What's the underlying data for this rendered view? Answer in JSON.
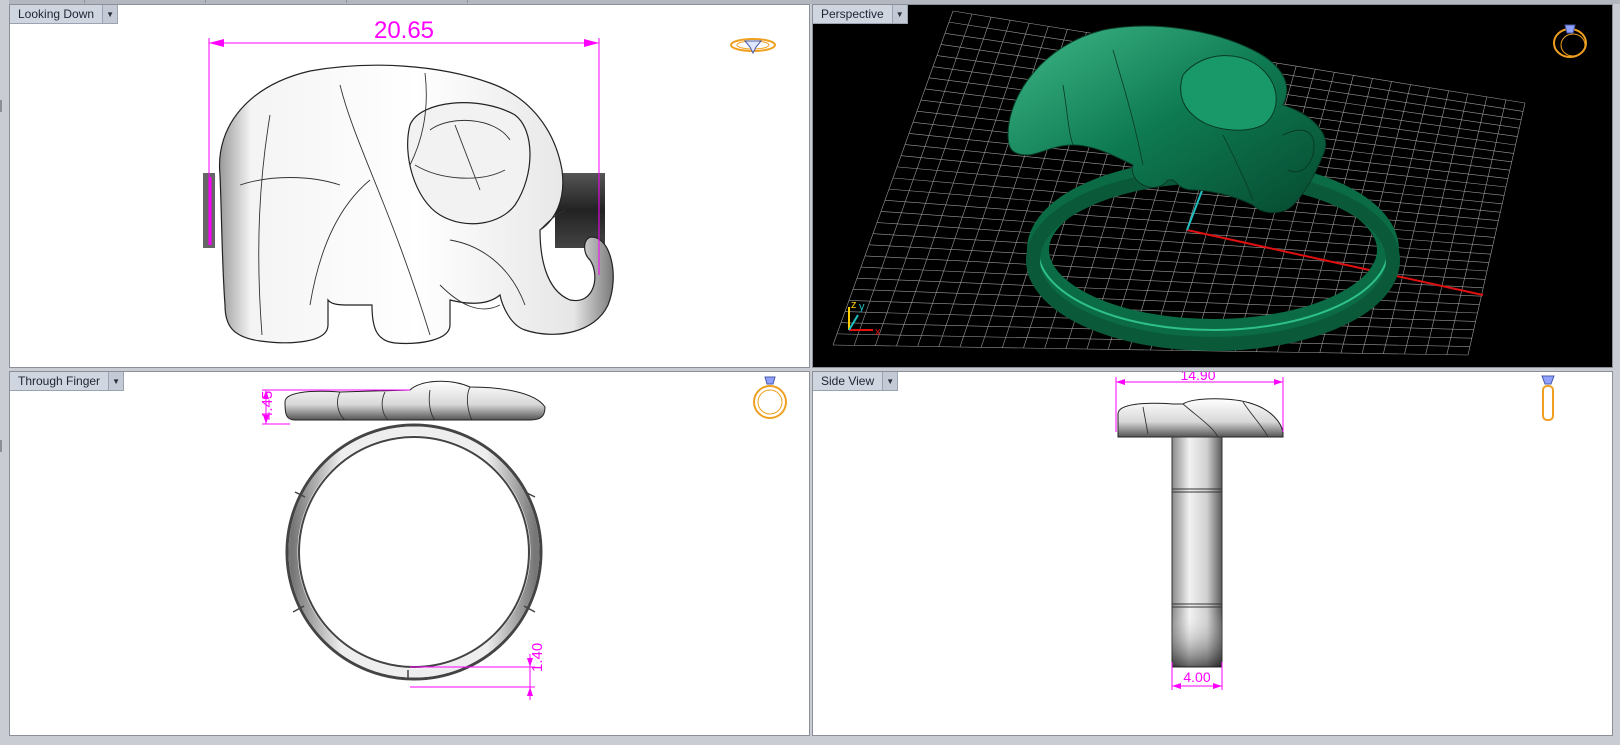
{
  "viewports": [
    {
      "title": "Looking Down",
      "dimensions": [
        "20.65"
      ]
    },
    {
      "title": "Perspective",
      "axis_labels": {
        "z": "z",
        "y": "y",
        "x": "x"
      }
    },
    {
      "title": "Through Finger",
      "dimensions": [
        "4.45",
        "1.40"
      ]
    },
    {
      "title": "Side View",
      "dimensions": [
        "14.90",
        "4.00"
      ]
    }
  ],
  "colors": {
    "dimension": "#ff00ff",
    "model_green": "#0f8a5a",
    "grid": "#9a9a9a",
    "axis_x": "#e01010",
    "axis_y": "#20c0c0",
    "view_icon": "#f0a020"
  },
  "icons": [
    "dropdown-arrow-icon",
    "view-gizmo-icon"
  ]
}
